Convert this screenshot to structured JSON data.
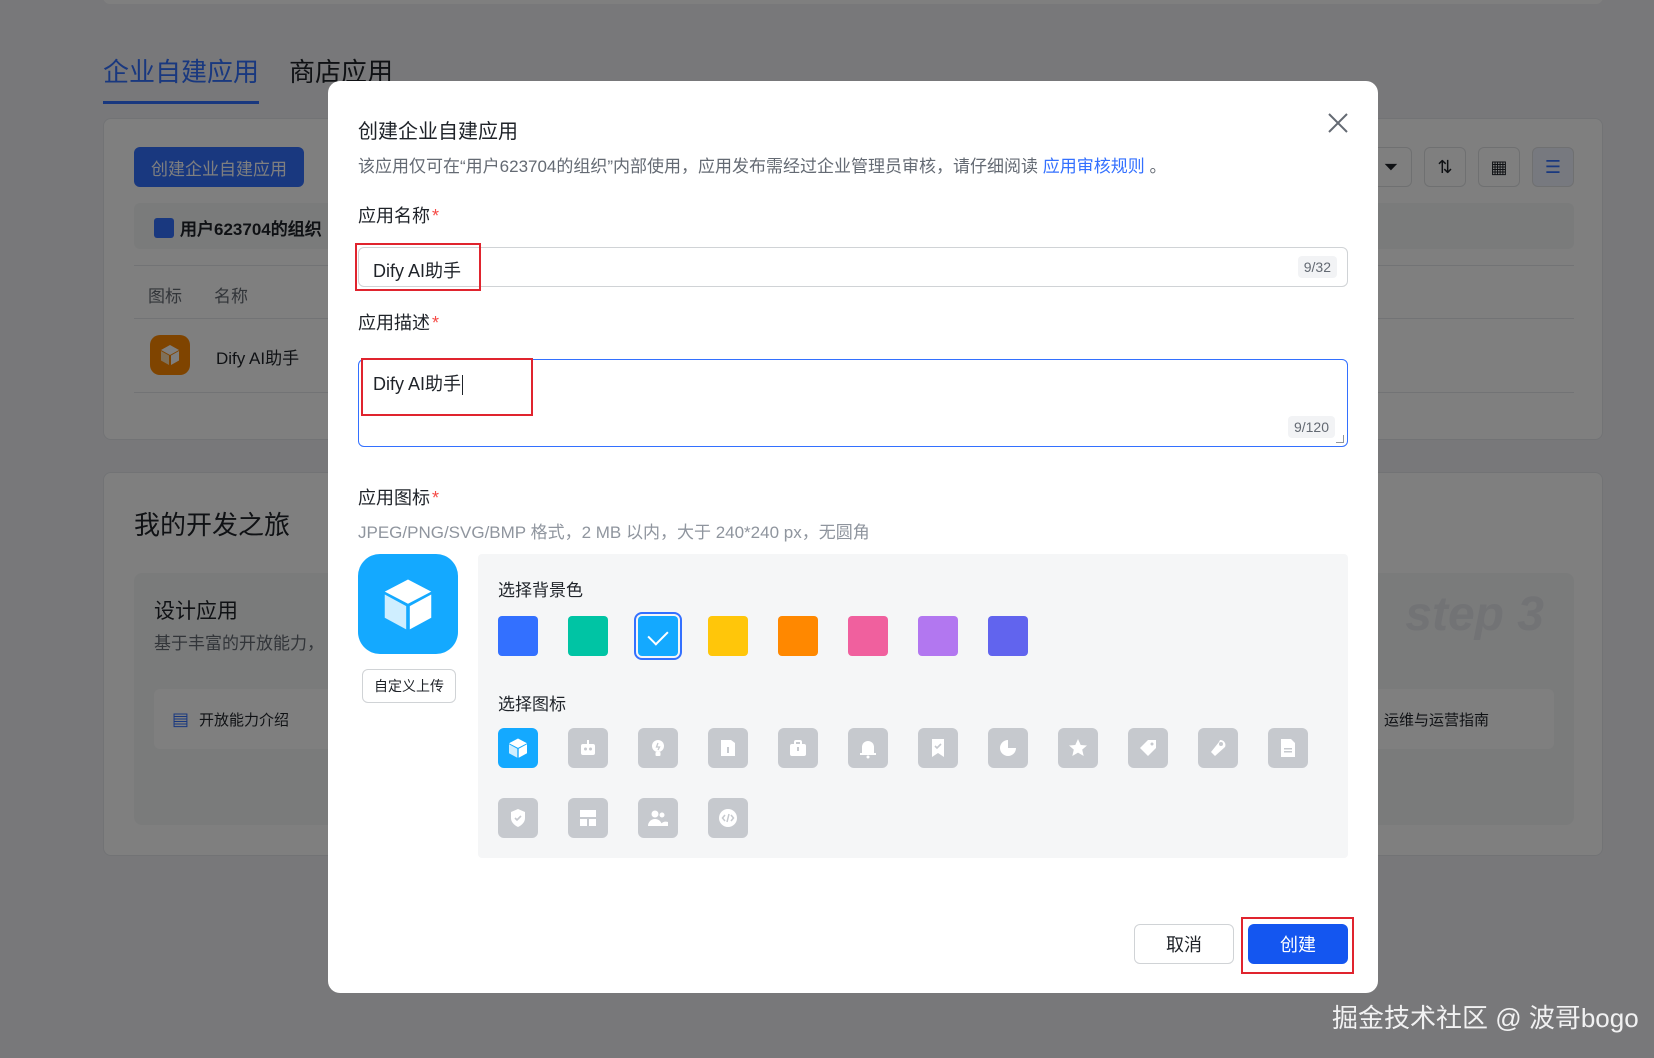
{
  "background": {
    "tabs": [
      {
        "label": "企业自建应用",
        "active": true
      },
      {
        "label": "商店应用",
        "active": false
      }
    ],
    "create_button": "创建企业自建应用",
    "org_name": "用户623704的组织",
    "columns": [
      "图标",
      "名称"
    ],
    "app_row": {
      "name": "Dify AI助手"
    },
    "journey_title": "我的开发之旅",
    "step": {
      "title": "设计应用",
      "subtitle": "基于丰富的开放能力，",
      "link": "开放能力介绍",
      "link_right": "运维与运营指南",
      "mark": "step 3"
    }
  },
  "dialog": {
    "title": "创建企业自建应用",
    "description": "该应用仅可在“用户623704的组织”内部使用，应用发布需经过企业管理员审核，请仔细阅读",
    "description_link": "应用审核规则",
    "description_end": "。",
    "name_field": {
      "label": "应用名称",
      "required_mark": "*",
      "value": "Dify AI助手",
      "counter": "9/32"
    },
    "desc_field": {
      "label": "应用描述",
      "required_mark": "*",
      "value": "Dify AI助手",
      "counter": "9/120"
    },
    "icon_field": {
      "label": "应用图标",
      "required_mark": "*",
      "hint": "JPEG/PNG/SVG/BMP 格式，2 MB 以内，大于 240*240 px，无圆角",
      "upload_button": "自定义上传",
      "bg_label": "选择背景色",
      "icon_label": "选择图标",
      "colors": [
        "#3370ff",
        "#00c4a4",
        "#14a9ff",
        "#ffc60a",
        "#ff8800",
        "#f0609e",
        "#b277f0",
        "#6164ee"
      ],
      "selected_color_index": 2,
      "icons": [
        "cube-icon",
        "robot-icon",
        "bulb-icon",
        "book-icon",
        "briefcase-icon",
        "bell-icon",
        "bookmark-check-icon",
        "pie-chart-icon",
        "star-icon",
        "tag-icon",
        "wrench-icon",
        "document-icon",
        "shield-check-icon",
        "layout-icon",
        "users-icon",
        "code-icon"
      ],
      "selected_icon_index": 0
    },
    "cancel_button": "取消",
    "create_button": "创建"
  },
  "watermark": "掘金技术社区 @ 波哥bogo"
}
